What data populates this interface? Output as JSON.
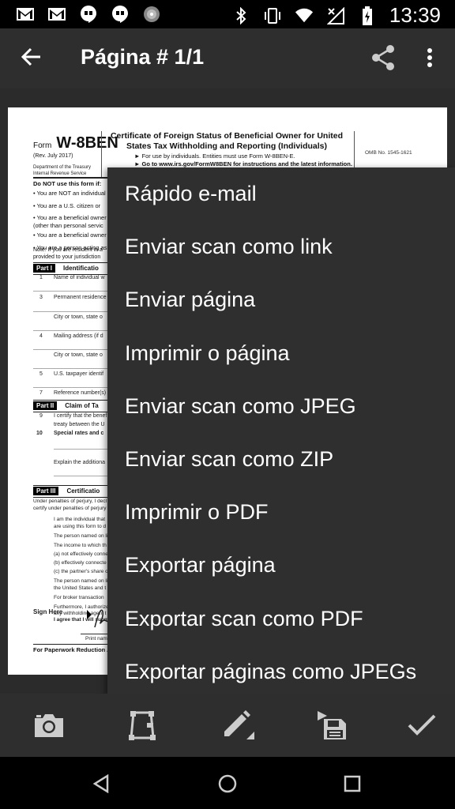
{
  "status_bar": {
    "time": "13:39",
    "left_icons": [
      "gmail-icon",
      "gmail-icon",
      "hangouts-icon",
      "hangouts-icon",
      "dots-app-icon"
    ],
    "right_icons": [
      "bluetooth-icon",
      "vibrate-icon",
      "wifi-icon",
      "no-signal-icon",
      "battery-charging-icon"
    ]
  },
  "toolbar": {
    "title": "Página # 1/1",
    "back_icon": "arrow-back-icon",
    "share_icon": "share-icon",
    "more_icon": "more-vert-icon"
  },
  "document": {
    "form_prefix": "Form",
    "form_number": "W-8BEN",
    "revision": "(Rev. July 2017)",
    "department": "Department of the Treasury Internal Revenue Service",
    "title": "Certificate of Foreign Status of Beneficial Owner for United States Tax Withholding and Reporting (Individuals)",
    "subtitle_1": "► For use by individuals. Entities must use Form W-8BEN-E.",
    "subtitle_2": "► Go to www.irs.gov/FormW8BEN for instructions and the latest information.",
    "omb": "OMB No. 1545-1621",
    "do_not_use": "Do NOT use this form if:",
    "bullets": [
      "• You are NOT an individual",
      "• You are a U.S. citizen or",
      "• You are a beneficial owner",
      "   (other than personal servic",
      "• You are a beneficial owner",
      "• You are a person acting as"
    ],
    "note_1": "Note: If you are resident in a",
    "note_2": "provided to your jurisdiction",
    "part1_tag": "Part I",
    "part1_title": "Identificatio",
    "part1_lines": [
      {
        "num": "1",
        "text": "Name of individual w"
      },
      {
        "num": "3",
        "text": "Permanent residence"
      },
      {
        "num": "",
        "text": "City or town, state o"
      },
      {
        "num": "4",
        "text": "Mailing address (if d"
      },
      {
        "num": "",
        "text": "City or town, state o"
      },
      {
        "num": "5",
        "text": "U.S. taxpayer identif"
      },
      {
        "num": "7",
        "text": "Reference number(s)"
      }
    ],
    "part2_tag": "Part II",
    "part2_title": "Claim of Ta",
    "part2_lines": [
      {
        "num": "9",
        "text": "I certify that the benef"
      },
      {
        "num": "",
        "text": "treaty between the U"
      },
      {
        "num": "10",
        "text": "Special rates and c"
      },
      {
        "num": "",
        "text": "Explain the additiona"
      }
    ],
    "part3_tag": "Part III",
    "part3_title": "Certificatio",
    "part3_intro_1": "Under penalties of perjury, I decl",
    "part3_intro_2": "certify under penalties of perjury",
    "part3_items": [
      "I am the individual that",
      "are using this form to d",
      "The person named on li",
      "The income to which th",
      "(a) not effectively conne",
      "(b) effectively connecte",
      "(c) the partner's share o",
      "The person named on li",
      "the United States and t",
      "For broker transaction",
      "Furthermore, I authorize",
      "any withholding agent t",
      "I agree that I will subm"
    ],
    "sign_here": "Sign Here",
    "print_name": "Print nam",
    "paperwork": "For Paperwork Reduction A"
  },
  "menu": {
    "items": [
      "Rápido e-mail",
      "Enviar scan como link",
      "Enviar página",
      "Imprimir o página",
      "Enviar scan como JPEG",
      "Enviar scan como ZIP",
      "Imprimir o PDF",
      "Exportar página",
      "Exportar scan como PDF",
      "Exportar páginas como JPEGs"
    ]
  },
  "action_bar": {
    "icons": [
      "camera-icon",
      "crop-icon",
      "pencil-icon",
      "save-icon",
      "check-icon"
    ]
  },
  "nav_bar": {
    "icons": [
      "nav-back-icon",
      "nav-home-icon",
      "nav-recents-icon"
    ]
  },
  "colors": {
    "bar": "#2e2e2e",
    "menu": "#2f2f2f",
    "status": "#000000",
    "text": "#ffffff"
  }
}
